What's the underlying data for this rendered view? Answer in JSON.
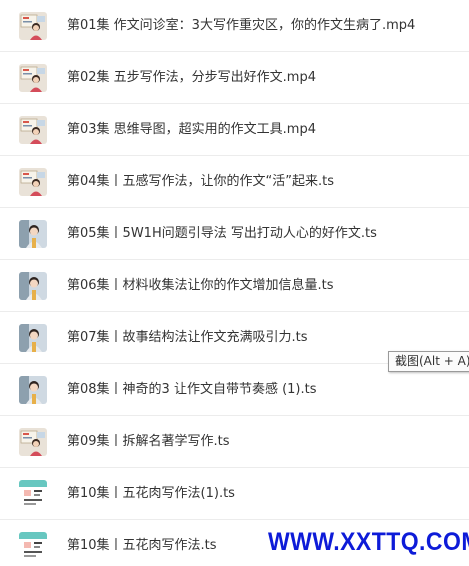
{
  "files": [
    {
      "name": "第01集 作文问诊室：3大写作重灾区，你的作文生病了.mp4",
      "thumb": "kid-whiteboard"
    },
    {
      "name": "第02集 五步写作法，分步写出好作文.mp4",
      "thumb": "kid-whiteboard"
    },
    {
      "name": "第03集 思维导图，超实用的作文工具.mp4",
      "thumb": "kid-whiteboard"
    },
    {
      "name": "第04集丨五感写作法，让你的作文“活”起来.ts",
      "thumb": "kid-whiteboard"
    },
    {
      "name": "第05集丨5W1H问题引导法 写出打动人心的好作文.ts",
      "thumb": "kid-portrait"
    },
    {
      "name": "第06集丨材料收集法让你的作文增加信息量.ts",
      "thumb": "kid-portrait"
    },
    {
      "name": "第07集丨故事结构法让作文充满吸引力.ts",
      "thumb": "kid-portrait"
    },
    {
      "name": "第08集丨神奇的3 让作文自带节奏感 (1).ts",
      "thumb": "kid-portrait"
    },
    {
      "name": "第09集丨拆解名著学写作.ts",
      "thumb": "kid-whiteboard"
    },
    {
      "name": "第10集丨五花肉写作法(1).ts",
      "thumb": "worksheet"
    },
    {
      "name": "第10集丨五花肉写作法.ts",
      "thumb": "worksheet"
    }
  ],
  "tooltip": "截图(Alt + A)",
  "watermark": "WWW.XXTTQ.COM",
  "colors": {
    "text": "#333333",
    "divider": "#ececec",
    "watermark": "#0d1bd8"
  }
}
